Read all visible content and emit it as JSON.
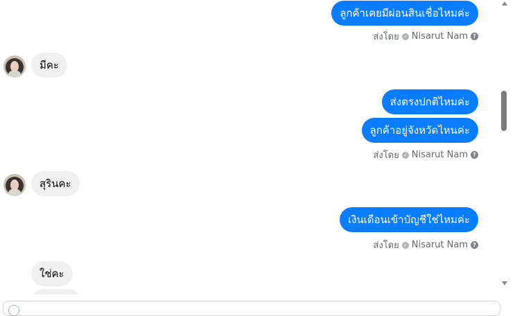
{
  "conversation": {
    "sent_by_label": "ส่งโดย",
    "agent_name": "Nisarut Nam",
    "messages": [
      {
        "direction": "out",
        "text": "ลูกค้าเคยมีผ่อนสินเชื่อไหมค่ะ"
      },
      {
        "direction": "in",
        "text": "มีคะ"
      },
      {
        "direction": "out",
        "text": "ส่งตรงปกติไหมค่ะ"
      },
      {
        "direction": "out",
        "text": "ลูกค้าอยู่จังหวัดไหนค่ะ"
      },
      {
        "direction": "in",
        "text": "สุรินคะ"
      },
      {
        "direction": "out",
        "text": "เงินเดือนเข้าบัญชีใช่ไหมค่ะ"
      },
      {
        "direction": "in",
        "text": "ใช่คะ"
      }
    ]
  },
  "colors": {
    "outgoing_bubble": "#0a7cff",
    "incoming_bubble": "#f0f0f0",
    "meta_text": "#65676b"
  },
  "icons": {
    "sent_status": "check-circle-icon",
    "help": "question-circle-icon",
    "scroll_up": "triangle-up-icon",
    "scroll_down": "triangle-down-icon"
  }
}
